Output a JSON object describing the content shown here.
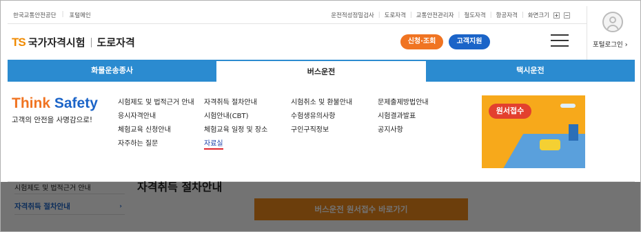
{
  "top_bar": {
    "left_links": [
      "한국교통안전공단",
      "포털메인"
    ],
    "right_links": [
      "운전적성정밀검사",
      "도로자격",
      "교통안전관리자",
      "철도자격",
      "항공자격"
    ],
    "zoom_label": "화면크기",
    "zoom_in": "+",
    "zoom_out": "−"
  },
  "header": {
    "logo_ts": "TS",
    "logo_name": "국가자격시험",
    "logo_sub": "도로자격",
    "apply_button": "신청·조회",
    "support_button": "고객지원"
  },
  "portal": {
    "login_label": "포털로그인 ›"
  },
  "nav": {
    "tabs": [
      "화물운송종사",
      "버스운전",
      "택시운전"
    ],
    "active_index": 1
  },
  "dropdown": {
    "think_a": "Think ",
    "think_b": "Safety",
    "slogan": "고객의 안전을 사명감으로!",
    "col1": [
      "시험제도 및 법적근거 안내",
      "응시자격안내",
      "체험교육 신청안내",
      "자주하는 질문"
    ],
    "col2": [
      "자격취득 절차안내",
      "시험안내(CBT)",
      "체험교육 일정 및 장소",
      "자료실"
    ],
    "col3": [
      "시험취소 및 환불안내",
      "수험생유의사항",
      "구인구직정보"
    ],
    "col4": [
      "문제출제방법안내",
      "시험결과발표",
      "공지사항"
    ],
    "highlighted": "자료실",
    "banner_label": "원서접수"
  },
  "background_page": {
    "side_item_1": "시험제도 및 법적근거 안내",
    "side_item_2": "자격취득 절차안내",
    "side_item_2_arrow": "›",
    "title": "자격취득 절차안내",
    "cta": "버스운전 원서접수 바로가기"
  },
  "colors": {
    "nav_blue": "#2b8bd0",
    "orange": "#f07422",
    "blue_btn": "#1b64c8",
    "highlight_red": "#e0222a"
  }
}
